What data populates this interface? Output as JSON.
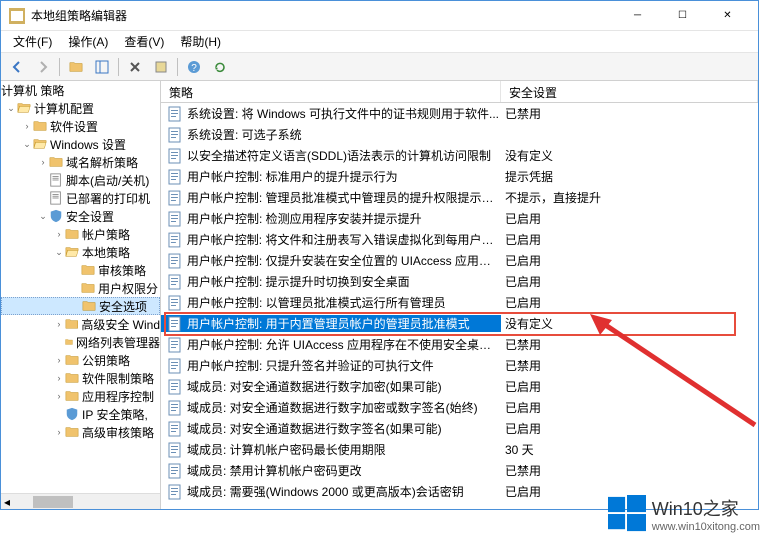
{
  "window": {
    "title": "本地组策略编辑器"
  },
  "menu": {
    "file": "文件(F)",
    "action": "操作(A)",
    "view": "查看(V)",
    "help": "帮助(H)"
  },
  "tree": {
    "root": "计算机 策略",
    "computer_config": "计算机配置",
    "software_settings": "软件设置",
    "windows_settings": "Windows 设置",
    "dns_policy": "域名解析策略",
    "scripts": "脚本(启动/关机)",
    "printers": "已部署的打印机",
    "security_settings": "安全设置",
    "account_policy": "帐户策略",
    "local_policy": "本地策略",
    "audit_policy": "审核策略",
    "user_rights": "用户权限分",
    "security_options": "安全选项",
    "adv_security_win": "高级安全 Wind",
    "network_list": "网络列表管理器",
    "public_key": "公钥策略",
    "soft_restrict": "软件限制策略",
    "app_control": "应用程序控制",
    "ip_security": "IP 安全策略,",
    "adv_audit": "高级审核策略"
  },
  "list": {
    "header_policy": "策略",
    "header_setting": "安全设置",
    "rows": [
      {
        "policy": "系统设置: 将 Windows 可执行文件中的证书规则用于软件...",
        "setting": "已禁用"
      },
      {
        "policy": "系统设置: 可选子系统",
        "setting": ""
      },
      {
        "policy": "以安全描述符定义语言(SDDL)语法表示的计算机访问限制",
        "setting": "没有定义"
      },
      {
        "policy": "用户帐户控制: 标准用户的提升提示行为",
        "setting": "提示凭据"
      },
      {
        "policy": "用户帐户控制: 管理员批准模式中管理员的提升权限提示的...",
        "setting": "不提示，直接提升"
      },
      {
        "policy": "用户帐户控制: 检测应用程序安装并提示提升",
        "setting": "已启用"
      },
      {
        "policy": "用户帐户控制: 将文件和注册表写入错误虚拟化到每用户位置",
        "setting": "已启用"
      },
      {
        "policy": "用户帐户控制: 仅提升安装在安全位置的 UIAccess 应用程序",
        "setting": "已启用"
      },
      {
        "policy": "用户帐户控制: 提示提升时切换到安全桌面",
        "setting": "已启用"
      },
      {
        "policy": "用户帐户控制: 以管理员批准模式运行所有管理员",
        "setting": "已启用"
      },
      {
        "policy": "用户帐户控制: 用于内置管理员帐户的管理员批准模式",
        "setting": "没有定义",
        "selected": true
      },
      {
        "policy": "用户帐户控制: 允许 UIAccess 应用程序在不使用安全桌面...",
        "setting": "已禁用"
      },
      {
        "policy": "用户帐户控制: 只提升签名并验证的可执行文件",
        "setting": "已禁用"
      },
      {
        "policy": "域成员: 对安全通道数据进行数字加密(如果可能)",
        "setting": "已启用"
      },
      {
        "policy": "域成员: 对安全通道数据进行数字加密或数字签名(始终)",
        "setting": "已启用"
      },
      {
        "policy": "域成员: 对安全通道数据进行数字签名(如果可能)",
        "setting": "已启用"
      },
      {
        "policy": "域成员: 计算机帐户密码最长使用期限",
        "setting": "30 天"
      },
      {
        "policy": "域成员: 禁用计算机帐户密码更改",
        "setting": "已禁用"
      },
      {
        "policy": "域成员: 需要强(Windows 2000 或更高版本)会话密钥",
        "setting": "已启用"
      }
    ]
  },
  "watermark": {
    "brand": "Win10之家",
    "url": "www.win10xitong.com"
  }
}
